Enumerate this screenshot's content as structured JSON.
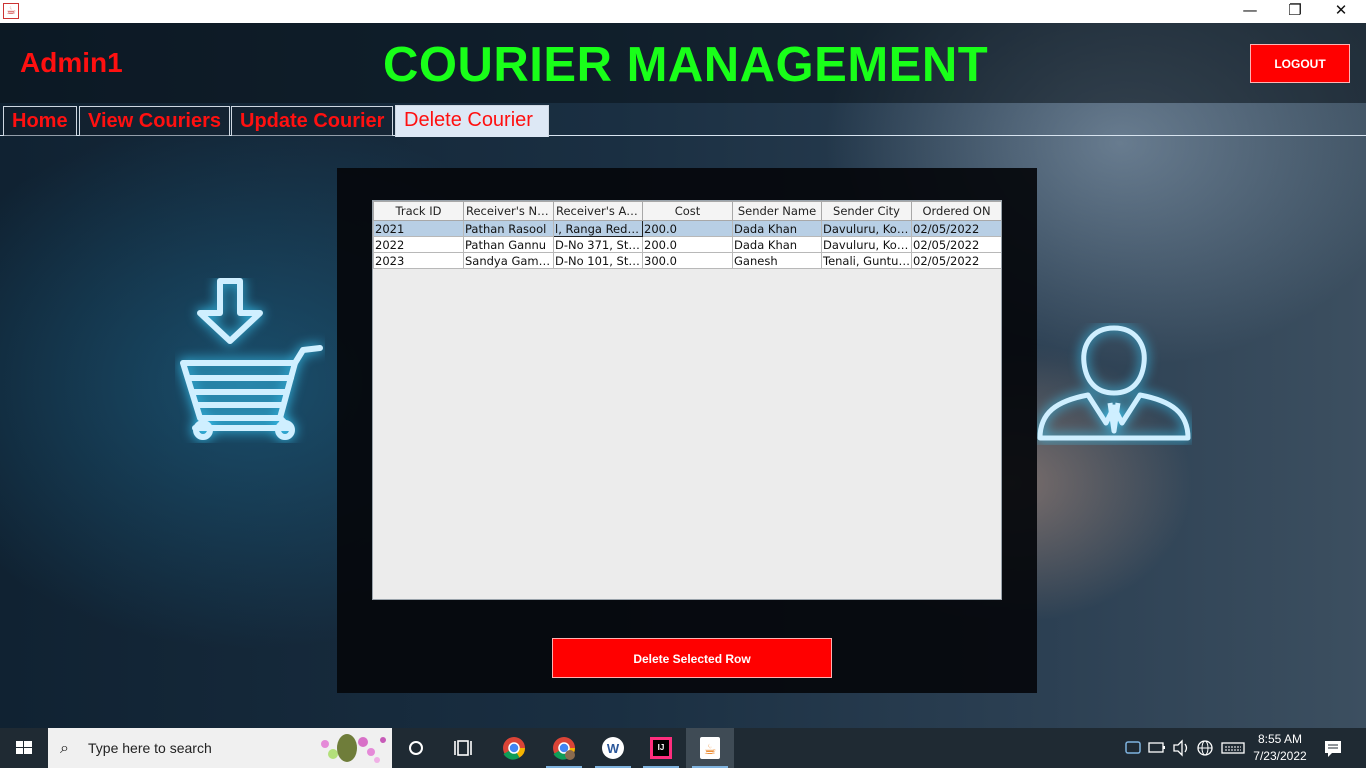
{
  "window": {
    "app_icon_glyph": "☕",
    "minimize_glyph": "—",
    "restore_glyph": "❐",
    "close_glyph": "✕"
  },
  "header": {
    "user": "Admin1",
    "title": "COURIER MANAGEMENT",
    "logout_label": "LOGOUT"
  },
  "tabs": [
    {
      "label": "Home"
    },
    {
      "label": "View Couriers"
    },
    {
      "label": "Update Courier"
    },
    {
      "label": "Delete Courier"
    }
  ],
  "active_tab": "Delete Courier",
  "table": {
    "columns": [
      "Track ID",
      "Receiver's Na...",
      "Receiver's Ad...",
      "Cost",
      "Sender Name",
      "Sender City",
      "Ordered ON"
    ],
    "rows": [
      [
        "2021",
        "Pathan Rasool",
        "l, Ranga Reddy",
        "200.0",
        "Dada Khan",
        "Davuluru, Koll...",
        "02/05/2022"
      ],
      [
        "2022",
        "Pathan Gannu",
        "D-No 371, Str...",
        "200.0",
        "Dada Khan",
        "Davuluru, Koll...",
        "02/05/2022"
      ],
      [
        "2023",
        "Sandya Gamidi",
        "D-No 101, Str...",
        "300.0",
        "Ganesh",
        "Tenali, Guntur...",
        "02/05/2022"
      ]
    ],
    "selected_row": 0
  },
  "delete_button_label": "Delete Selected Row",
  "taskbar": {
    "search_placeholder": "Type here to search",
    "time": "8:55 AM",
    "date": "7/23/2022"
  },
  "colors": {
    "title_green": "#19ff19",
    "accent_red": "#ff0000",
    "selection_blue": "#b8cfe5"
  }
}
